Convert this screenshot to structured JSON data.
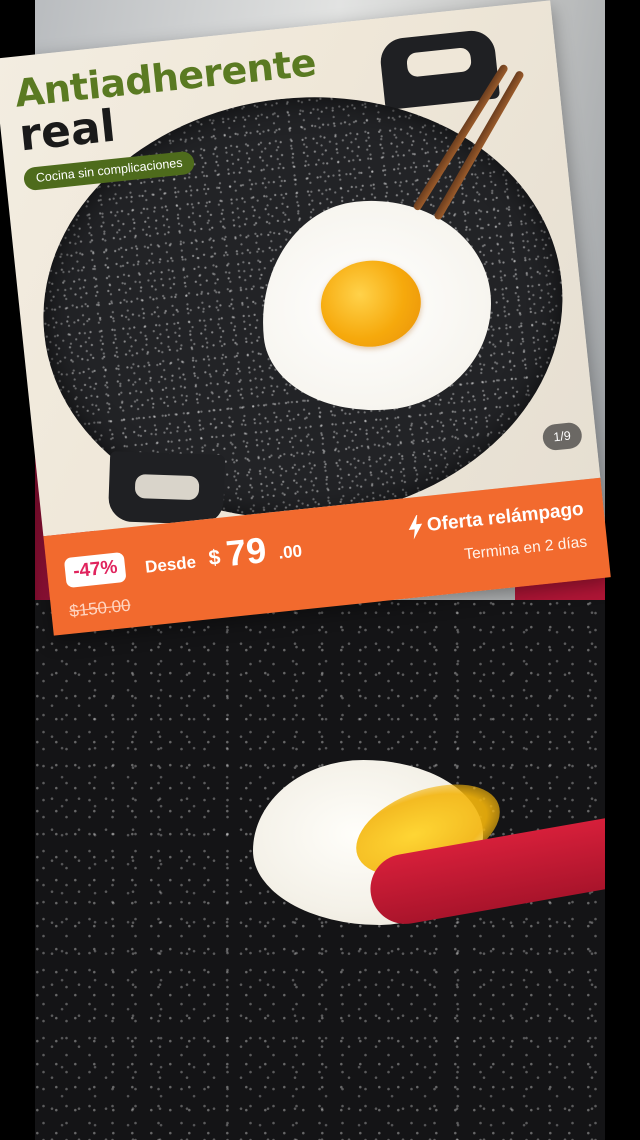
{
  "card": {
    "headline_line1": "Antiadherente",
    "headline_line2": "real",
    "subtitle": "Cocina sin complicaciones",
    "page_counter": "1/9"
  },
  "price": {
    "discount": "-47%",
    "prefix": "Desde",
    "currency": "$",
    "integer": "79",
    "decimals": ".00",
    "old_price": "$150.00"
  },
  "flash_sale": {
    "title": "Oferta relámpago",
    "subtitle": "Termina en 2 días",
    "icon": "lightning-bolt-icon"
  },
  "colors": {
    "banner_orange": "#f26a2e",
    "headline_green": "#5a7a22",
    "pill_green": "#4e6b1c",
    "discount_pink": "#e0245e"
  }
}
